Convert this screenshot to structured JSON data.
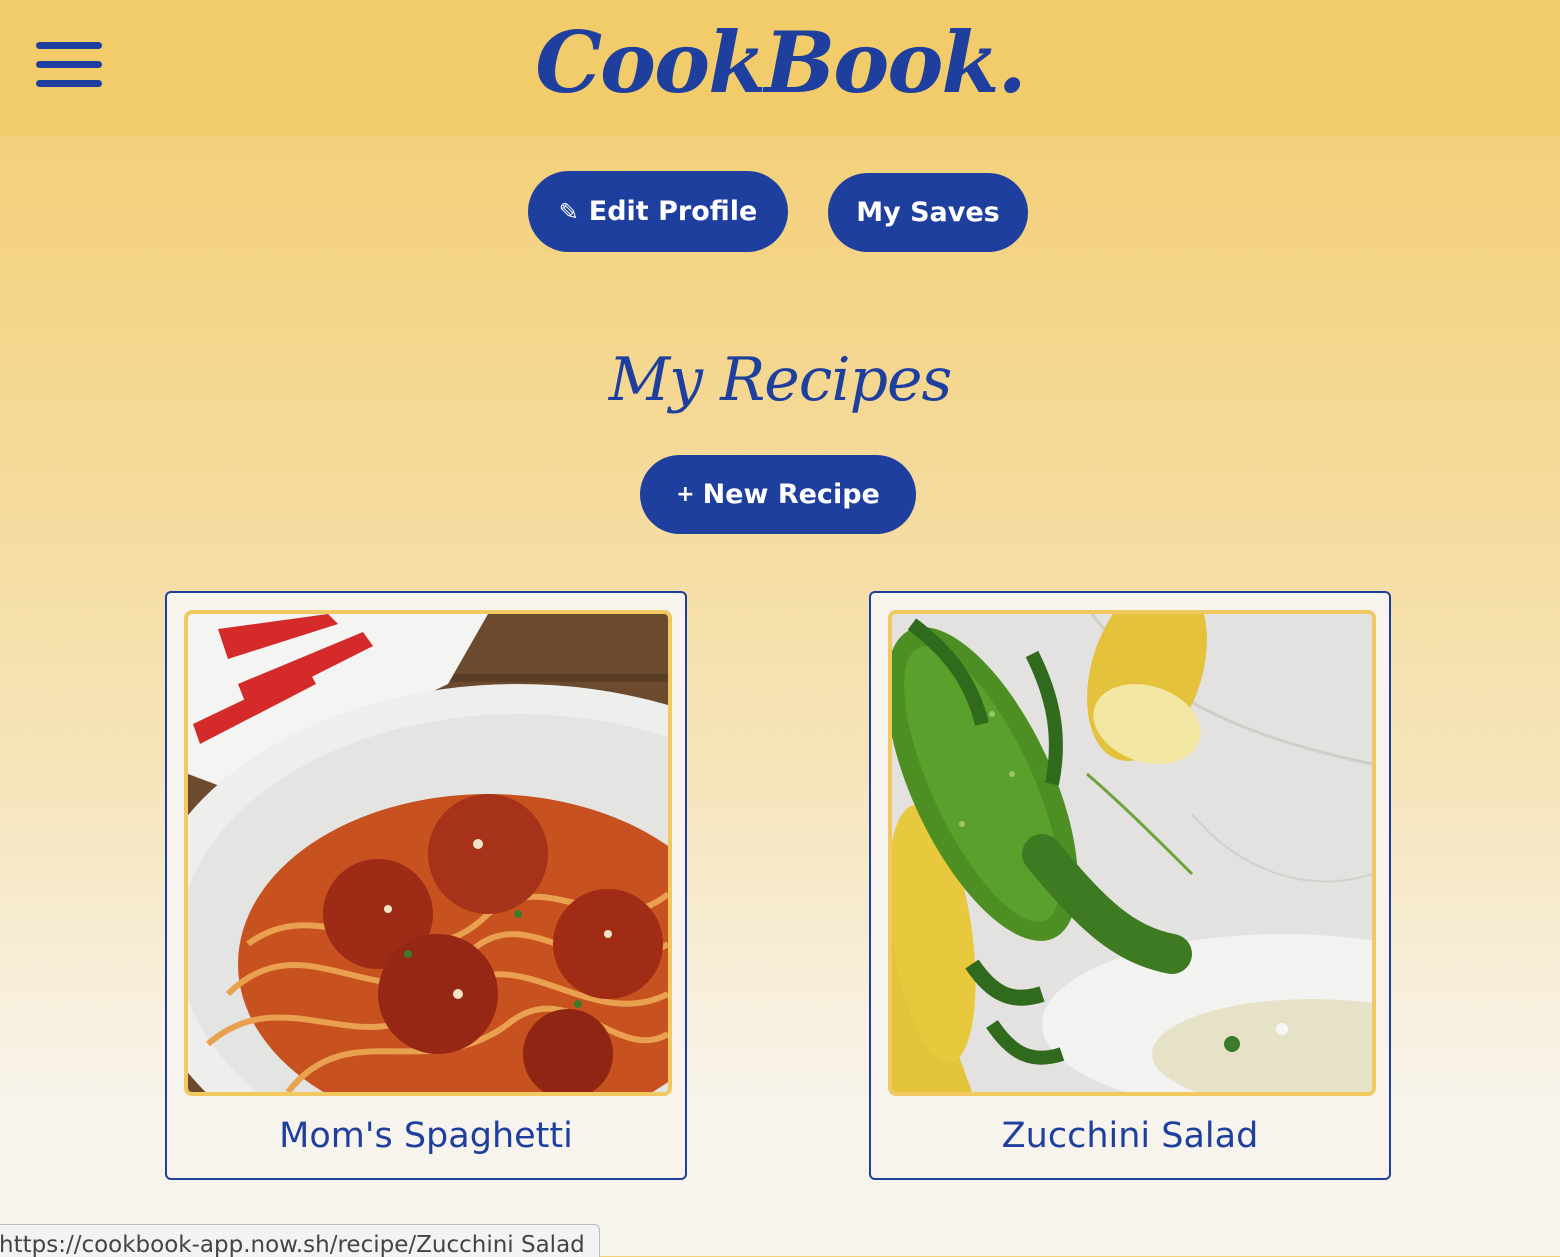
{
  "header": {
    "brand": "CookBook.",
    "menu_icon": "hamburger-menu-icon"
  },
  "profile_actions": {
    "edit_profile_icon": "pencil-icon",
    "edit_profile_label": "Edit Profile",
    "my_saves_label": "My Saves"
  },
  "section": {
    "title": "My Recipes",
    "new_recipe_icon": "plus-icon",
    "new_recipe_label": "New Recipe"
  },
  "recipes": [
    {
      "title": "Mom's Spaghetti",
      "image": "spaghetti-meatballs-photo"
    },
    {
      "title": "Zucchini Salad",
      "image": "zucchini-squash-mint-photo"
    }
  ],
  "status_bar": {
    "url": "https://cookbook-app.now.sh/recipe/Zucchini Salad"
  },
  "colors": {
    "brand_blue": "#1f3f9f",
    "header_yellow": "#f2cb6b",
    "image_border": "#f2c860"
  }
}
